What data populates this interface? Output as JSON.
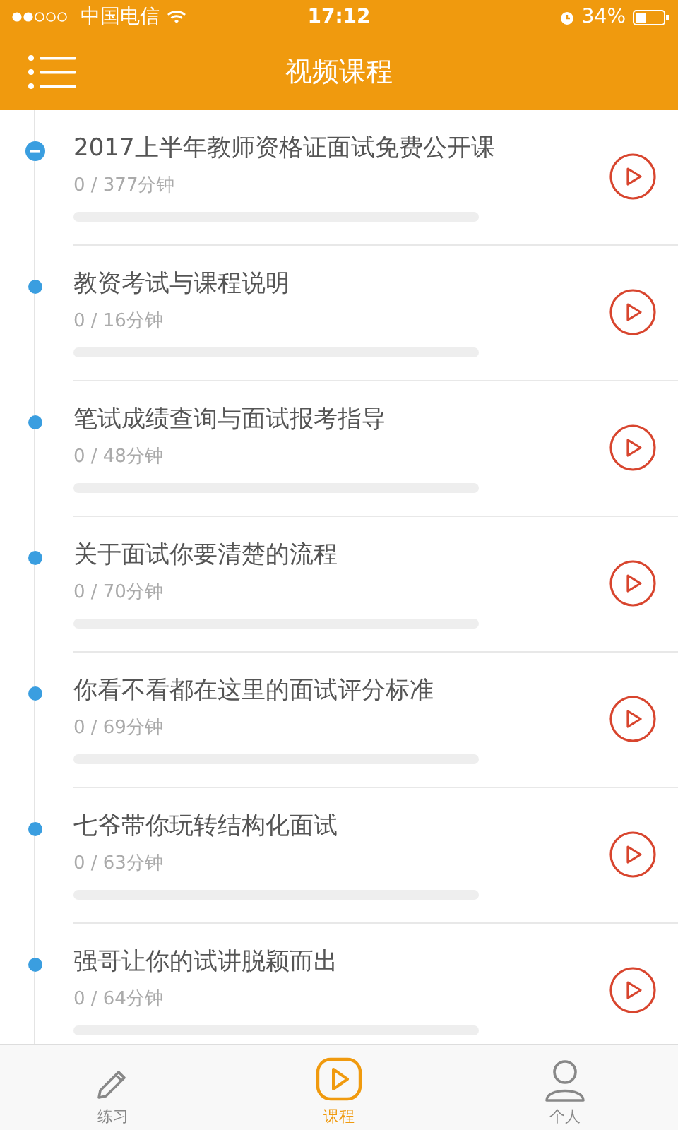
{
  "status_bar": {
    "carrier": "中国电信",
    "time": "17:12",
    "battery_percent": "34%"
  },
  "header": {
    "title": "视频课程"
  },
  "lessons": [
    {
      "title": "2017上半年教师资格证面试免费公开课",
      "progress": "0 / 377分钟",
      "expanded": true
    },
    {
      "title": "教资考试与课程说明",
      "progress": "0 / 16分钟",
      "expanded": false
    },
    {
      "title": "笔试成绩查询与面试报考指导",
      "progress": "0 / 48分钟",
      "expanded": false
    },
    {
      "title": "关于面试你要清楚的流程",
      "progress": "0 / 70分钟",
      "expanded": false
    },
    {
      "title": "你看不看都在这里的面试评分标准",
      "progress": "0 / 69分钟",
      "expanded": false
    },
    {
      "title": "七爷带你玩转结构化面试",
      "progress": "0 / 63分钟",
      "expanded": false
    },
    {
      "title": "强哥让你的试讲脱颖而出",
      "progress": "0 / 64分钟",
      "expanded": false
    }
  ],
  "tab_bar": [
    {
      "label": "练习",
      "selected": false
    },
    {
      "label": "课程",
      "selected": true
    },
    {
      "label": "个人",
      "selected": false
    }
  ]
}
